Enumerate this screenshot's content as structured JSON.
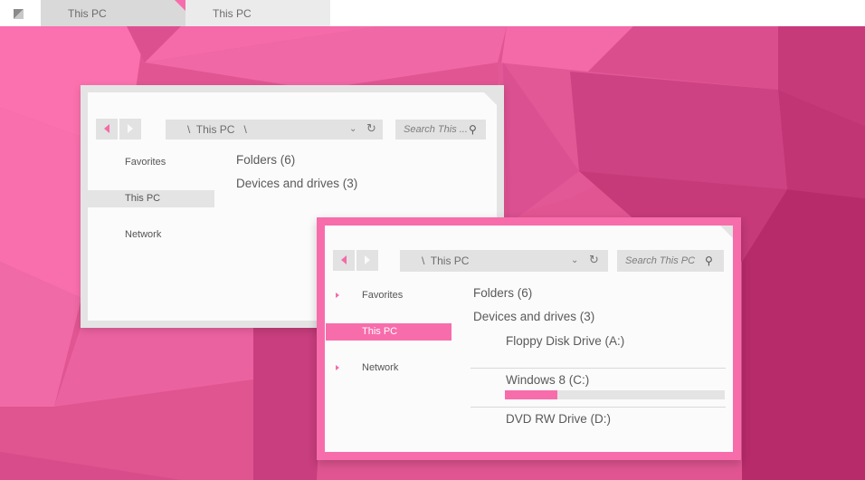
{
  "tabbar": {
    "app_icon": "app-icon",
    "tabs": [
      {
        "label": "This PC",
        "active": true
      },
      {
        "label": "This PC",
        "active": false
      }
    ]
  },
  "colors": {
    "accent": "#f76dab",
    "window_frame_grey": "#e4e4e4",
    "window_bg": "#fbfbfb",
    "bar_track": "#e4e4e4",
    "text": "#5a5a5a"
  },
  "window_back": {
    "nav": {
      "back_icon": "triangle-left-icon",
      "forward_icon": "triangle-right-icon"
    },
    "address": {
      "path": "\\  This PC   \\",
      "dropdown_icon": "chevron-down-icon",
      "refresh_icon": "refresh-icon"
    },
    "search": {
      "placeholder": "Search This ...",
      "icon": "search-icon"
    },
    "sidebar": [
      {
        "label": "Favorites",
        "selected": false
      },
      {
        "label": "This PC",
        "selected": true
      },
      {
        "label": "Network",
        "selected": false
      }
    ],
    "content": {
      "folders": "Folders (6)",
      "devices": "Devices and drives (3)"
    }
  },
  "window_front": {
    "nav": {
      "back_icon": "triangle-left-icon",
      "forward_icon": "triangle-right-icon"
    },
    "address": {
      "path": "\\  This PC",
      "dropdown_icon": "chevron-down-icon",
      "refresh_icon": "refresh-icon"
    },
    "search": {
      "placeholder": "Search This PC",
      "icon": "search-icon"
    },
    "sidebar": [
      {
        "label": "Favorites",
        "selected": false,
        "expandable": true
      },
      {
        "label": "This PC",
        "selected": true,
        "expandable": false
      },
      {
        "label": "Network",
        "selected": false,
        "expandable": true
      }
    ],
    "content": {
      "folders": "Folders (6)",
      "devices": "Devices and drives (3)",
      "drives": [
        {
          "name": "Floppy Disk Drive (A:)"
        },
        {
          "name": "Windows 8 (C:)",
          "used_fraction": 0.24
        },
        {
          "name": "DVD RW Drive (D:)"
        }
      ]
    }
  }
}
